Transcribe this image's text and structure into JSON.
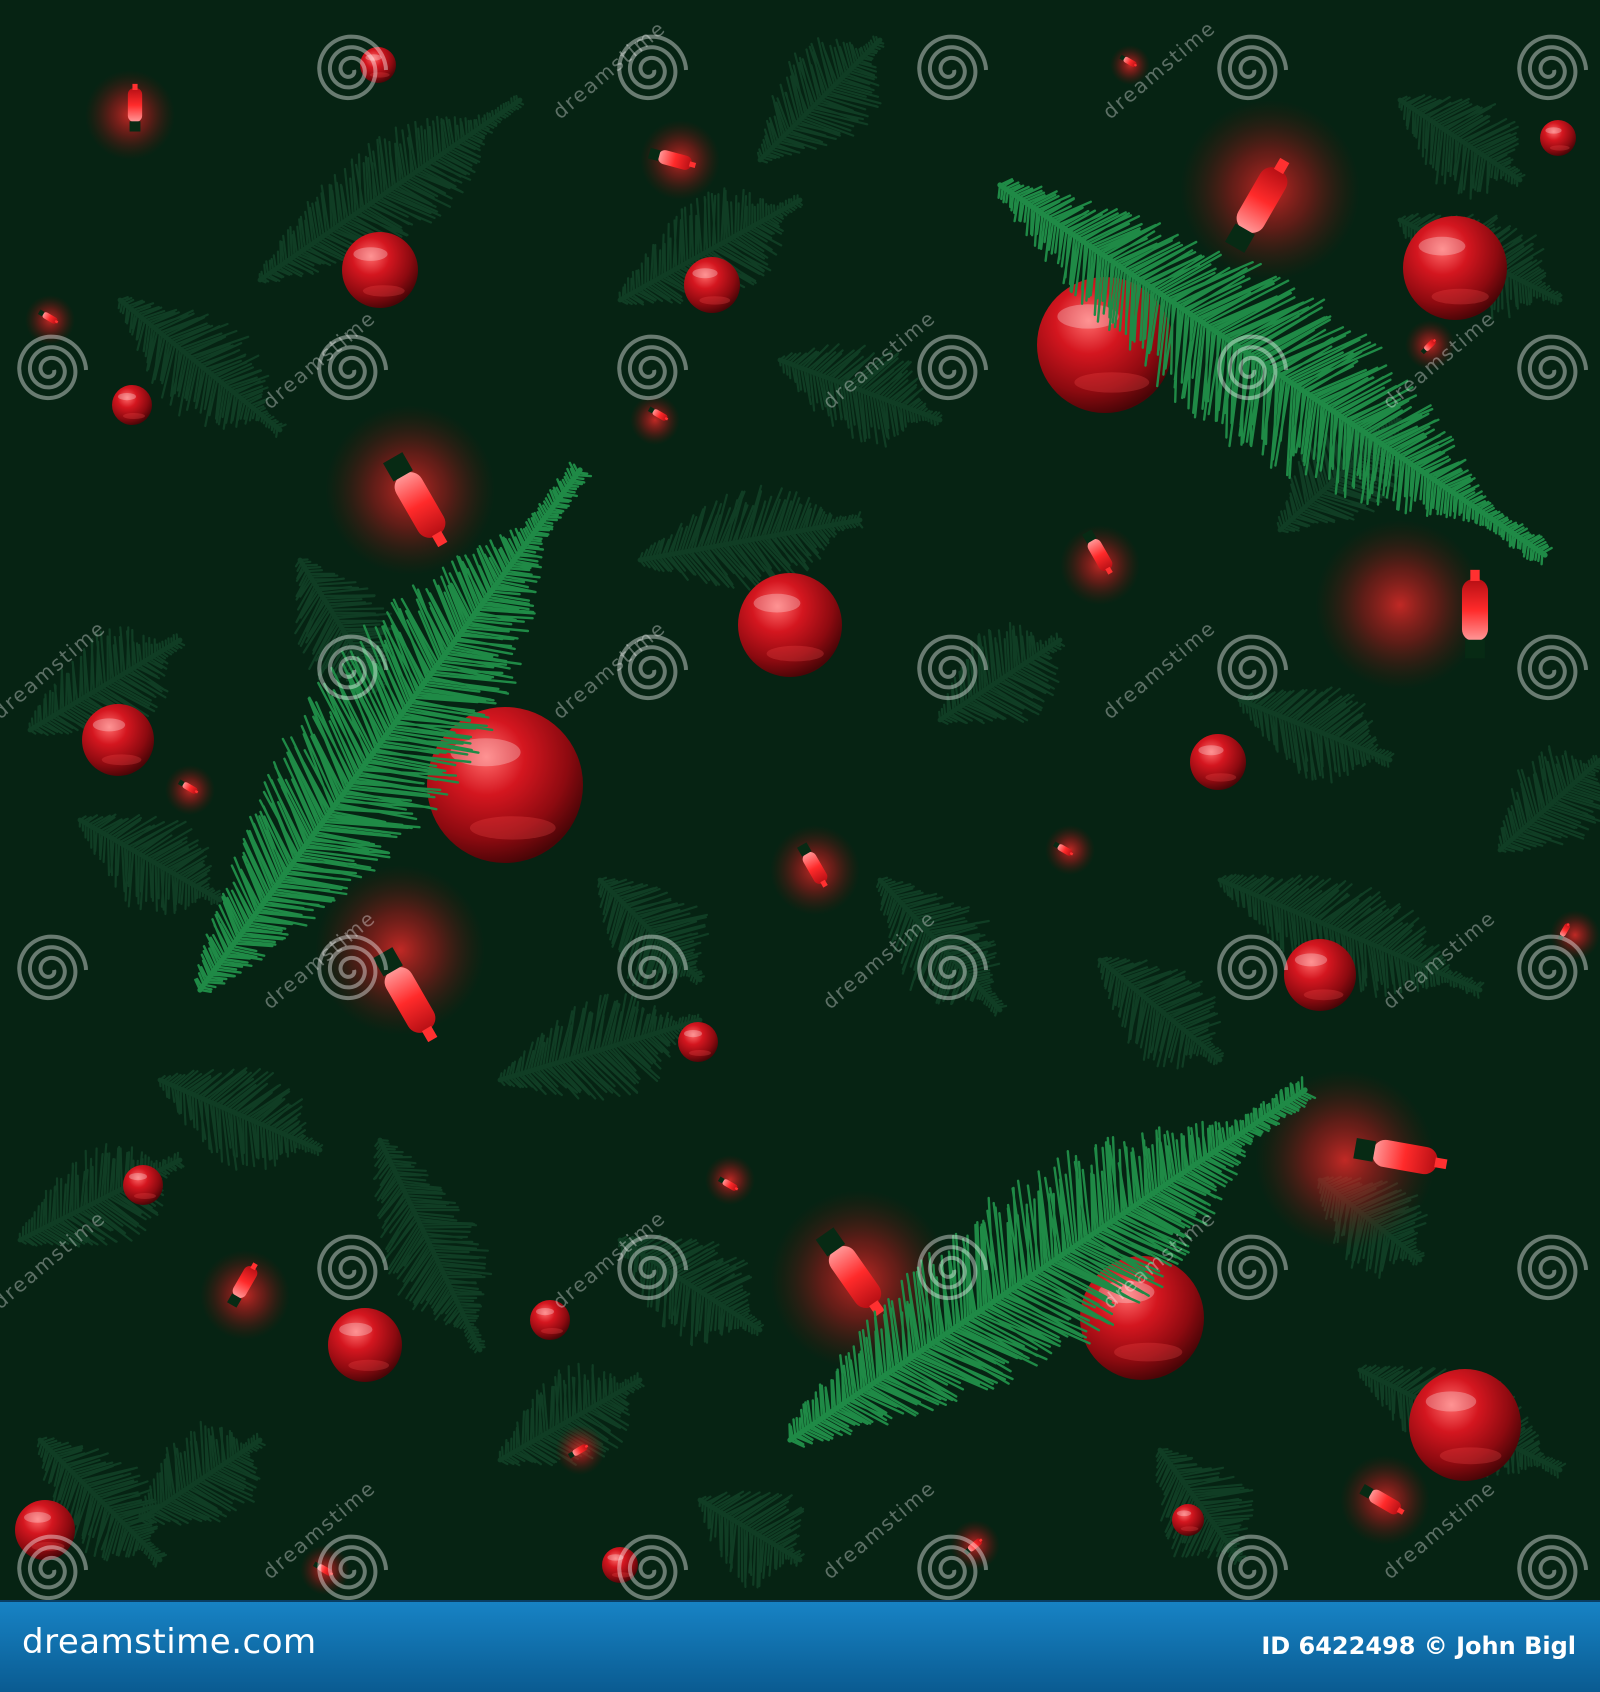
{
  "image": {
    "description_colors": {
      "background": "#062313",
      "branch_bright": "#1a8a45",
      "branch_dark": "#0e3b22",
      "ornament_red": "#c0141c",
      "light_red": "#ff3a3a",
      "footer_bar": "#0b6fa8"
    }
  },
  "watermark": {
    "text": "dreamstime",
    "icon": "spiral-icon"
  },
  "footer": {
    "logo_text": "dreamstime.com",
    "credit_text": "ID 6422498 © John Bigl"
  }
}
